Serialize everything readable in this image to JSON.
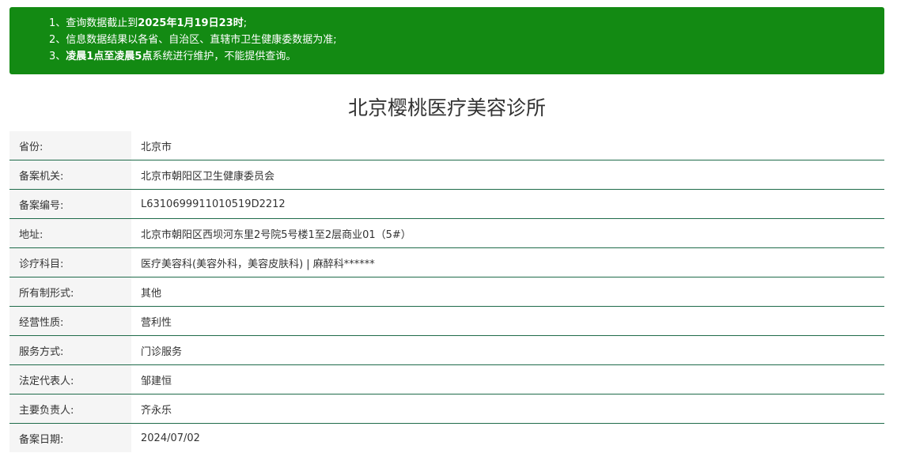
{
  "notice": {
    "lines": [
      {
        "prefix": "1、查询数据截止到",
        "bold": "2025年1月19日23时",
        "suffix": ";"
      },
      {
        "prefix": "2、信息数据结果以各省、自治区、直辖市卫生健康委数据为准;",
        "bold": "",
        "suffix": ""
      },
      {
        "prefix": "3、",
        "bold": "凌晨1点至凌晨5点",
        "suffix": "系统进行维护，不能提供查询。"
      }
    ]
  },
  "title": "北京樱桃医疗美容诊所",
  "rows": [
    {
      "label": "省份:",
      "value": "北京市"
    },
    {
      "label": "备案机关:",
      "value": "北京市朝阳区卫生健康委员会"
    },
    {
      "label": "备案编号:",
      "value": "L6310699911010519D2212"
    },
    {
      "label": "地址:",
      "value": "北京市朝阳区西坝河东里2号院5号楼1至2层商业01（5#）"
    },
    {
      "label": "诊疗科目:",
      "value": "医疗美容科(美容外科，美容皮肤科) | 麻醉科******"
    },
    {
      "label": "所有制形式:",
      "value": "其他"
    },
    {
      "label": "经营性质:",
      "value": "营利性"
    },
    {
      "label": "服务方式:",
      "value": "门诊服务"
    },
    {
      "label": "法定代表人:",
      "value": "邹建恒"
    },
    {
      "label": "主要负责人:",
      "value": "齐永乐"
    },
    {
      "label": "备案日期:",
      "value": "2024/07/02"
    }
  ],
  "colors": {
    "notice_bg": "#138a13",
    "row_border": "#1f6b4a",
    "label_bg": "#f5f5f5"
  }
}
